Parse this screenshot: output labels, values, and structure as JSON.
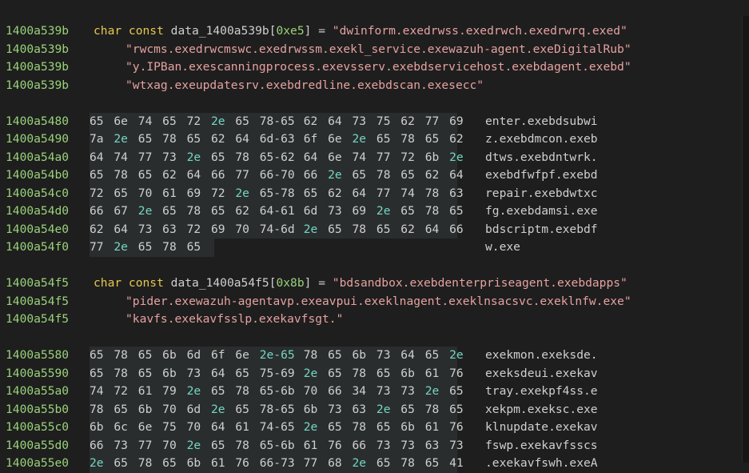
{
  "block1": {
    "addr": "1400a539b",
    "decl": {
      "kw": "char const",
      "name": "data_1400a539b",
      "open": "[",
      "size": "0xe5",
      "close": "]",
      "eq": " = ",
      "str": "\"dwinform.exedrwss.exedrwch.exedrwrq.exed\""
    },
    "cont": [
      {
        "addr": "1400a539b",
        "str": "\"rwcms.exedrwcmswc.exedrwssm.exekl_service.exewazuh-agent.exeDigitalRub\""
      },
      {
        "addr": "1400a539b",
        "str": "\"y.IPBan.exescanningprocess.exevsserv.exebdservicehost.exebdagent.exebd\""
      },
      {
        "addr": "1400a539b",
        "str": "\"wtxag.exeupdatesrv.exebdredline.exebdscan.exesecc\""
      }
    ]
  },
  "hex1": [
    {
      "addr": "1400a5480",
      "bytes": [
        "65",
        "6e",
        "74",
        "65",
        "72",
        "2e",
        "65",
        "78-65",
        "62",
        "64",
        "73",
        "75",
        "62",
        "77",
        "69"
      ],
      "ascii": "enter.exebdsubwi"
    },
    {
      "addr": "1400a5490",
      "bytes": [
        "7a",
        "2e",
        "65",
        "78",
        "65",
        "62",
        "64",
        "6d-63",
        "6f",
        "6e",
        "2e",
        "65",
        "78",
        "65",
        "62"
      ],
      "ascii": "z.exebdmcon.exeb"
    },
    {
      "addr": "1400a54a0",
      "bytes": [
        "64",
        "74",
        "77",
        "73",
        "2e",
        "65",
        "78",
        "65-62",
        "64",
        "6e",
        "74",
        "77",
        "72",
        "6b",
        "2e"
      ],
      "ascii": "dtws.exebdntwrk."
    },
    {
      "addr": "1400a54b0",
      "bytes": [
        "65",
        "78",
        "65",
        "62",
        "64",
        "66",
        "77",
        "66-70",
        "66",
        "2e",
        "65",
        "78",
        "65",
        "62",
        "64"
      ],
      "ascii": "exebdfwfpf.exebd"
    },
    {
      "addr": "1400a54c0",
      "bytes": [
        "72",
        "65",
        "70",
        "61",
        "69",
        "72",
        "2e",
        "65-78",
        "65",
        "62",
        "64",
        "77",
        "74",
        "78",
        "63"
      ],
      "ascii": "repair.exebdwtxc"
    },
    {
      "addr": "1400a54d0",
      "bytes": [
        "66",
        "67",
        "2e",
        "65",
        "78",
        "65",
        "62",
        "64-61",
        "6d",
        "73",
        "69",
        "2e",
        "65",
        "78",
        "65"
      ],
      "ascii": "fg.exebdamsi.exe"
    },
    {
      "addr": "1400a54e0",
      "bytes": [
        "62",
        "64",
        "73",
        "63",
        "72",
        "69",
        "70",
        "74-6d",
        "2e",
        "65",
        "78",
        "65",
        "62",
        "64",
        "66"
      ],
      "ascii": "bdscriptm.exebdf"
    },
    {
      "addr": "1400a54f0",
      "bytes": [
        "77",
        "2e",
        "65",
        "78",
        "65"
      ],
      "ascii": "w.exe"
    }
  ],
  "block2": {
    "addr": "1400a54f5",
    "decl": {
      "kw": "char const",
      "name": "data_1400a54f5",
      "open": "[",
      "size": "0x8b",
      "close": "]",
      "eq": " = ",
      "str": "\"bdsandbox.exebdenterpriseagent.exebdapps\""
    },
    "cont": [
      {
        "addr": "1400a54f5",
        "str": "\"pider.exewazuh-agentavp.exeavpui.exeklnagent.exeklnsacsvc.exeklnfw.exe\""
      },
      {
        "addr": "1400a54f5",
        "str": "\"kavfs.exekavfsslp.exekavfsgt.\""
      }
    ]
  },
  "hex2": [
    {
      "addr": "1400a5580",
      "bytes": [
        "65",
        "78",
        "65",
        "6b",
        "6d",
        "6f",
        "6e",
        "2e-65",
        "78",
        "65",
        "6b",
        "73",
        "64",
        "65",
        "2e"
      ],
      "ascii": "exekmon.exeksde."
    },
    {
      "addr": "1400a5590",
      "bytes": [
        "65",
        "78",
        "65",
        "6b",
        "73",
        "64",
        "65",
        "75-69",
        "2e",
        "65",
        "78",
        "65",
        "6b",
        "61",
        "76"
      ],
      "ascii": "exeksdeui.exekav"
    },
    {
      "addr": "1400a55a0",
      "bytes": [
        "74",
        "72",
        "61",
        "79",
        "2e",
        "65",
        "78",
        "65-6b",
        "70",
        "66",
        "34",
        "73",
        "73",
        "2e",
        "65"
      ],
      "ascii": "tray.exekpf4ss.e"
    },
    {
      "addr": "1400a55b0",
      "bytes": [
        "78",
        "65",
        "6b",
        "70",
        "6d",
        "2e",
        "65",
        "78-65",
        "6b",
        "73",
        "63",
        "2e",
        "65",
        "78",
        "65"
      ],
      "ascii": "xekpm.exeksc.exe"
    },
    {
      "addr": "1400a55c0",
      "bytes": [
        "6b",
        "6c",
        "6e",
        "75",
        "70",
        "64",
        "61",
        "74-65",
        "2e",
        "65",
        "78",
        "65",
        "6b",
        "61",
        "76"
      ],
      "ascii": "klnupdate.exekav"
    },
    {
      "addr": "1400a55d0",
      "bytes": [
        "66",
        "73",
        "77",
        "70",
        "2e",
        "65",
        "78",
        "65-6b",
        "61",
        "76",
        "66",
        "73",
        "73",
        "63",
        "73"
      ],
      "ascii": "fswp.exekavfsscs"
    },
    {
      "addr": "1400a55e0",
      "bytes": [
        "2e",
        "65",
        "78",
        "65",
        "6b",
        "61",
        "76",
        "66-73",
        "77",
        "68",
        "2e",
        "65",
        "78",
        "65",
        "41"
      ],
      "ascii": ".exekavfswh.exeA"
    }
  ]
}
